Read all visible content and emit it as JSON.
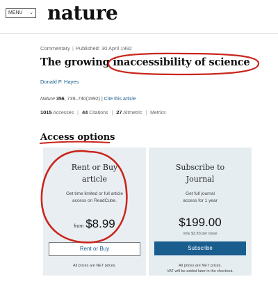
{
  "header": {
    "menu_label": "MENU",
    "brand": "nature"
  },
  "article": {
    "type": "Commentary",
    "published": "Published: 30 April 1992",
    "title": "The growing inaccessibility of science",
    "author": "Donald P. Hayes",
    "journal": "Nature",
    "volume": "356",
    "pages": "739–740(1992)",
    "cite_link": "Cite this article",
    "metrics": {
      "accesses_value": "1015",
      "accesses_label": "Accesses",
      "citations_value": "44",
      "citations_label": "Citations",
      "altmetric_value": "27",
      "altmetric_label": "Altmetric",
      "metrics_link": "Metrics"
    }
  },
  "access": {
    "heading": "Access options",
    "rent": {
      "title_line1": "Rent or Buy",
      "title_line2": "article",
      "desc_line1": "Get time limited or full article",
      "desc_line2": "access on ReadCube.",
      "from_label": "from",
      "price": "$8.99",
      "button_label": "Rent or Buy",
      "fine_print": "All prices are NET prices."
    },
    "subscribe": {
      "title_line1": "Subscribe to",
      "title_line2": "Journal",
      "desc_line1": "Get full journal",
      "desc_line2": "access for 1 year",
      "price": "$199.00",
      "per_issue": "only $3.83 per issue",
      "button_label": "Subscribe",
      "fine_line1": "All prices are NET prices.",
      "fine_line2": "VAT will be added later in the checkout."
    }
  },
  "colors": {
    "link": "#1a5d8f",
    "annotation": "#c9261c",
    "card_bg": "#e9eef2"
  }
}
